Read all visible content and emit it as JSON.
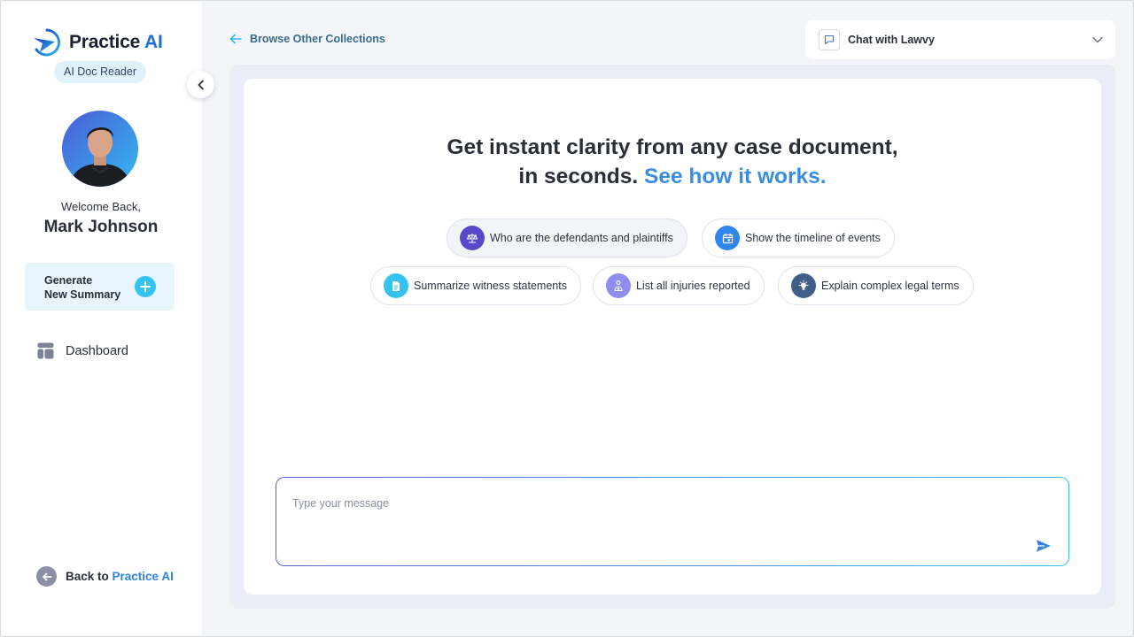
{
  "sidebar": {
    "brand_name": "Practice",
    "brand_suffix": "AI",
    "product_badge": "AI Doc Reader",
    "welcome_text": "Welcome Back,",
    "user_name": "Mark Johnson",
    "generate_label": "Generate\nNew Summary",
    "nav": [
      {
        "label": "Dashboard",
        "icon": "dashboard-icon"
      }
    ],
    "back_prefix": "Back to ",
    "back_target": "Practice AI"
  },
  "topbar": {
    "browse_label": "Browse Other Collections",
    "chat_select_value": "Chat with Lawvy"
  },
  "main": {
    "headline_line1": "Get instant clarity from any case document,",
    "headline_line2": "in seconds.",
    "headline_link": "See how it works.",
    "suggestions": [
      {
        "label": "Who are the defendants and plaintiffs",
        "icon": "scales-icon",
        "color": "#5a48c8"
      },
      {
        "label": "Show the timeline of events",
        "icon": "calendar-icon",
        "color": "#2f86ee"
      },
      {
        "label": "Summarize witness statements",
        "icon": "document-icon",
        "color": "#36c2f0"
      },
      {
        "label": "List all injuries reported",
        "icon": "injury-icon",
        "color": "#8d8ef0"
      },
      {
        "label": "Explain complex legal terms",
        "icon": "lightbulb-icon",
        "color": "#3f5f86"
      }
    ],
    "message_placeholder": "Type your message",
    "message_value": ""
  },
  "colors": {
    "accent": "#2e82e6",
    "badge_bg": "#dff1fb",
    "card_bg": "#e8f5fc",
    "plus": "#35c3ef"
  }
}
